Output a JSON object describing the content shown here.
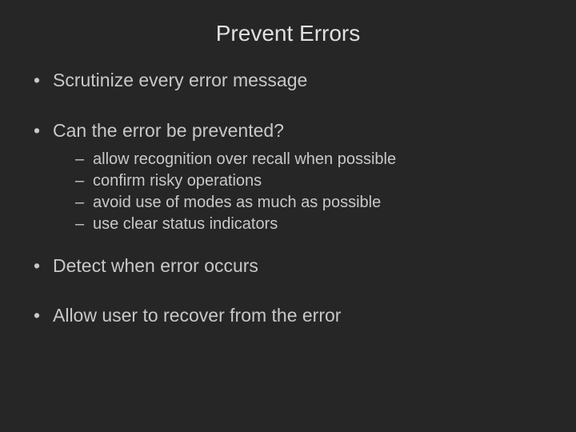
{
  "title": "Prevent Errors",
  "bullets": {
    "b0": {
      "text": "Scrutinize every error message"
    },
    "b1": {
      "text": "Can the error be prevented?",
      "sub": {
        "s0": "allow recognition over recall when possible",
        "s1": "confirm risky operations",
        "s2": "avoid use of modes as much as possible",
        "s3": "use clear status indicators"
      }
    },
    "b2": {
      "text": "Detect when error occurs"
    },
    "b3": {
      "text": "Allow user to recover from the error"
    }
  }
}
